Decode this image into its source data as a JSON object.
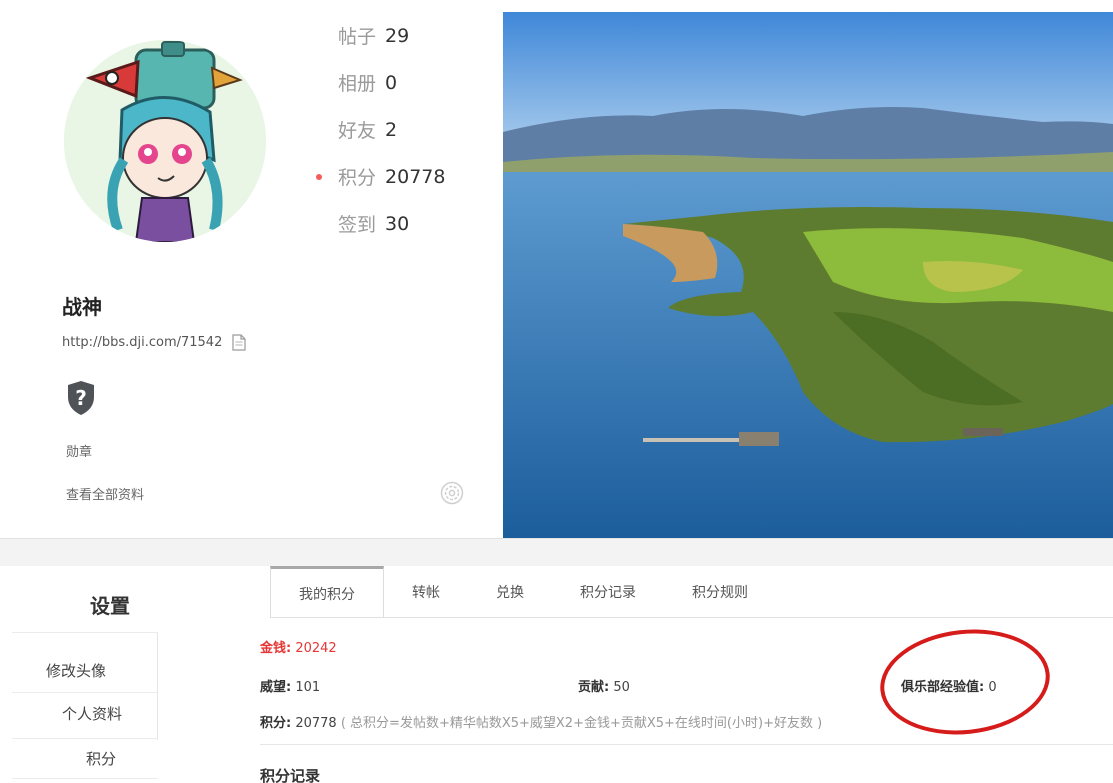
{
  "profile": {
    "stats": [
      {
        "label": "帖子",
        "value": "29"
      },
      {
        "label": "相册",
        "value": "0"
      },
      {
        "label": "好友",
        "value": "2"
      },
      {
        "label": "积分",
        "value": "20778"
      },
      {
        "label": "签到",
        "value": "30"
      }
    ],
    "username": "战神",
    "url": "http://bbs.dji.com/71542",
    "medal_label": "勋章",
    "view_all": "查看全部资料"
  },
  "sidebar": {
    "title": "设置",
    "items": [
      "修改头像",
      "个人资料",
      "积分"
    ]
  },
  "tabs": [
    "我的积分",
    "转帐",
    "兑换",
    "积分记录",
    "积分规则"
  ],
  "credits": {
    "money_label": "金钱:",
    "money_value": "20242",
    "prestige_label": "威望:",
    "prestige_value": "101",
    "contribution_label": "贡献:",
    "contribution_value": "50",
    "club_label": "俱乐部经验值:",
    "club_value": "0",
    "points_label": "积分:",
    "points_value": "20778",
    "formula": "( 总积分=发帖数+精华帖数X5+威望X2+金钱+贡献X5+在线时间(小时)+好友数 )"
  },
  "record_title": "积分记录",
  "colors": {
    "accent_red": "#e53535",
    "annotation_red": "#d61b1b"
  }
}
